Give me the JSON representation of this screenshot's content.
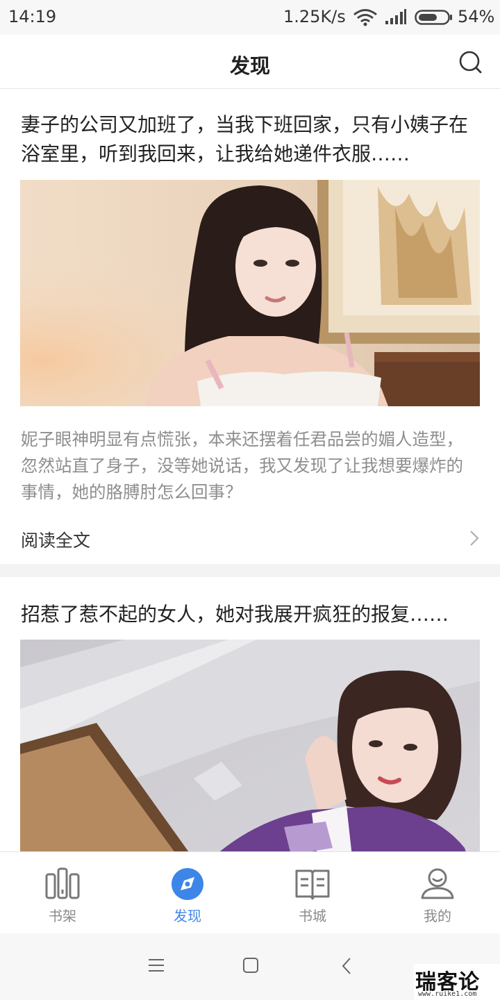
{
  "status_bar": {
    "time": "14:19",
    "net_speed": "1.25K/s",
    "battery": "54%"
  },
  "header": {
    "title": "发现",
    "search_icon": "search-icon"
  },
  "articles": [
    {
      "title": "妻子的公司又加班了，当我下班回家，只有小姨子在浴室里，听到我回来，让我给她递件衣服……",
      "image": "photo of a woman with long dark hair in a bedroom",
      "excerpt": " 妮子眼神明显有点慌张，本来还摆着任君品尝的媚人造型，忽然站直了身子，没等她说话，我又发现了让我想要爆炸的事情，她的胳膊肘怎么回事？",
      "read_more": "阅读全文"
    },
    {
      "title": "招惹了惹不起的女人，她对我展开疯狂的报复……",
      "image": "photo of a woman in a purple outfit near a ceiling"
    }
  ],
  "tab_bar": {
    "tabs": [
      {
        "label": "书架",
        "icon": "bookshelf-icon",
        "active": false
      },
      {
        "label": "发现",
        "icon": "compass-icon",
        "active": true
      },
      {
        "label": "书城",
        "icon": "book-icon",
        "active": false
      },
      {
        "label": "我的",
        "icon": "user-icon",
        "active": false
      }
    ],
    "active_color": "#3d86e8",
    "inactive_color": "#8a8a8a"
  },
  "system_nav": [
    "menu-icon",
    "home-icon",
    "back-icon"
  ],
  "watermark": {
    "text": "瑞客论坛",
    "url": "www.ruike1.com"
  }
}
